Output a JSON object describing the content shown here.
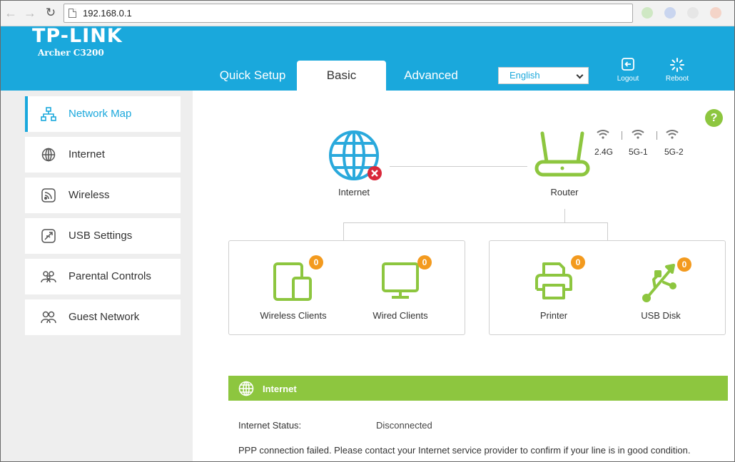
{
  "browser": {
    "url": "192.168.0.1",
    "back_icon": "arrow-left-icon",
    "forward_icon": "arrow-right-icon",
    "reload_icon": "reload-icon"
  },
  "header": {
    "brand": "TP-LINK",
    "model": "Archer C3200",
    "tabs": [
      {
        "label": "Quick Setup"
      },
      {
        "label": "Basic",
        "active": true
      },
      {
        "label": "Advanced"
      }
    ],
    "language": "English",
    "logout_label": "Logout",
    "reboot_label": "Reboot"
  },
  "sidebar": {
    "items": [
      {
        "label": "Network Map",
        "icon": "network-map-icon",
        "active": true
      },
      {
        "label": "Internet",
        "icon": "globe-icon"
      },
      {
        "label": "Wireless",
        "icon": "wireless-icon"
      },
      {
        "label": "USB Settings",
        "icon": "usb-settings-icon"
      },
      {
        "label": "Parental Controls",
        "icon": "parental-controls-icon"
      },
      {
        "label": "Guest Network",
        "icon": "guest-network-icon"
      }
    ]
  },
  "map": {
    "internet_label": "Internet",
    "router_label": "Router",
    "bands": [
      "2.4G",
      "5G-1",
      "5G-2"
    ],
    "devices": [
      {
        "label": "Wireless Clients",
        "count": "0"
      },
      {
        "label": "Wired Clients",
        "count": "0"
      },
      {
        "label": "Printer",
        "count": "0"
      },
      {
        "label": "USB Disk",
        "count": "0"
      }
    ]
  },
  "internet_section": {
    "title": "Internet",
    "status_label": "Internet Status:",
    "status_value": "Disconnected",
    "message": "PPP connection failed. Please contact your Internet service provider to confirm if your line is in good condition."
  },
  "colors": {
    "brand_blue": "#1aa8dc",
    "accent_green": "#8dc63f",
    "badge_orange": "#f39a1e",
    "error_red": "#d9283a"
  }
}
